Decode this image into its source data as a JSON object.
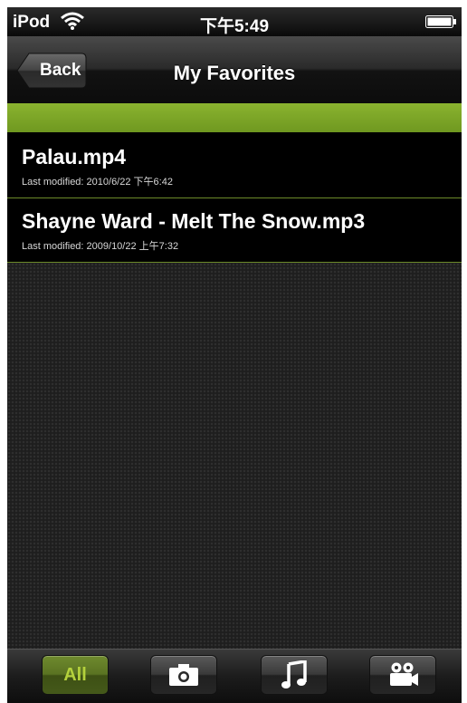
{
  "status_bar": {
    "carrier": "iPod",
    "time": "下午5:49",
    "wifi_icon": "wifi-icon",
    "battery_icon": "battery-icon"
  },
  "nav": {
    "back_label": "Back",
    "title": "My Favorites"
  },
  "files": [
    {
      "name": "Palau.mp4",
      "meta": "Last modified: 2010/6/22 下午6:42"
    },
    {
      "name": "Shayne Ward - Melt The Snow.mp3",
      "meta": "Last modified: 2009/10/22 上午7:32"
    }
  ],
  "tabs": {
    "all_label": "All",
    "photo_icon": "camera-icon",
    "music_icon": "music-note-icon",
    "video_icon": "video-camera-icon"
  },
  "colors": {
    "accent_green": "#7ca728",
    "active_tab_text": "#b4d13c"
  }
}
